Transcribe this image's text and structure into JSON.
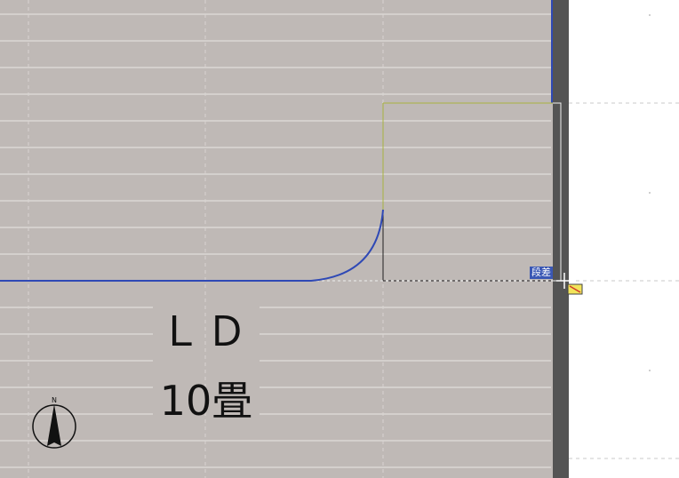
{
  "canvas": {
    "background_color": "#bfb9b6",
    "side_panel_color": "#ffffff",
    "wall_color": "#545454",
    "wall_line_color": "#2f49b5",
    "floor_line_color": "#e9e6e4",
    "selection_color": "#ffffff"
  },
  "room": {
    "name": "ＬＤ",
    "size": "10畳"
  },
  "step_tag": {
    "label": "段差",
    "color": "#3a57b4"
  },
  "compass": {
    "north_label": "N",
    "icon": "north-arrow-icon"
  },
  "cursor": {
    "icon": "crosshair-cursor-icon",
    "snap_icon": "snap-marker-icon"
  }
}
